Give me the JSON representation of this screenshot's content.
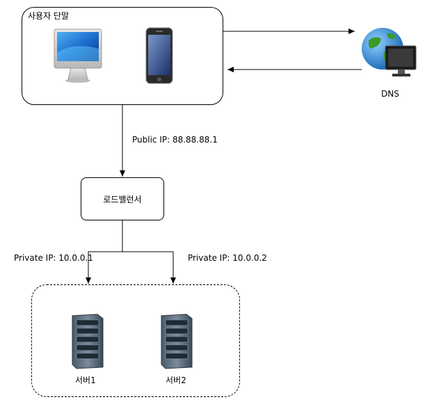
{
  "client_group": {
    "label": "사용자 단말"
  },
  "dns": {
    "label": "DNS"
  },
  "public_ip": {
    "label": "Public IP: 88.88.88.1"
  },
  "load_balancer": {
    "label": "로드밸런서"
  },
  "private_ip_1": {
    "label": "Private IP: 10.0.0.1"
  },
  "private_ip_2": {
    "label": "Private IP: 10.0.0.2"
  },
  "server1": {
    "label": "서버1"
  },
  "server2": {
    "label": "서버2"
  },
  "icons": {
    "desktop": "desktop-computer-icon",
    "phone": "smartphone-icon",
    "globe": "globe-monitor-icon",
    "server": "server-rack-icon"
  }
}
